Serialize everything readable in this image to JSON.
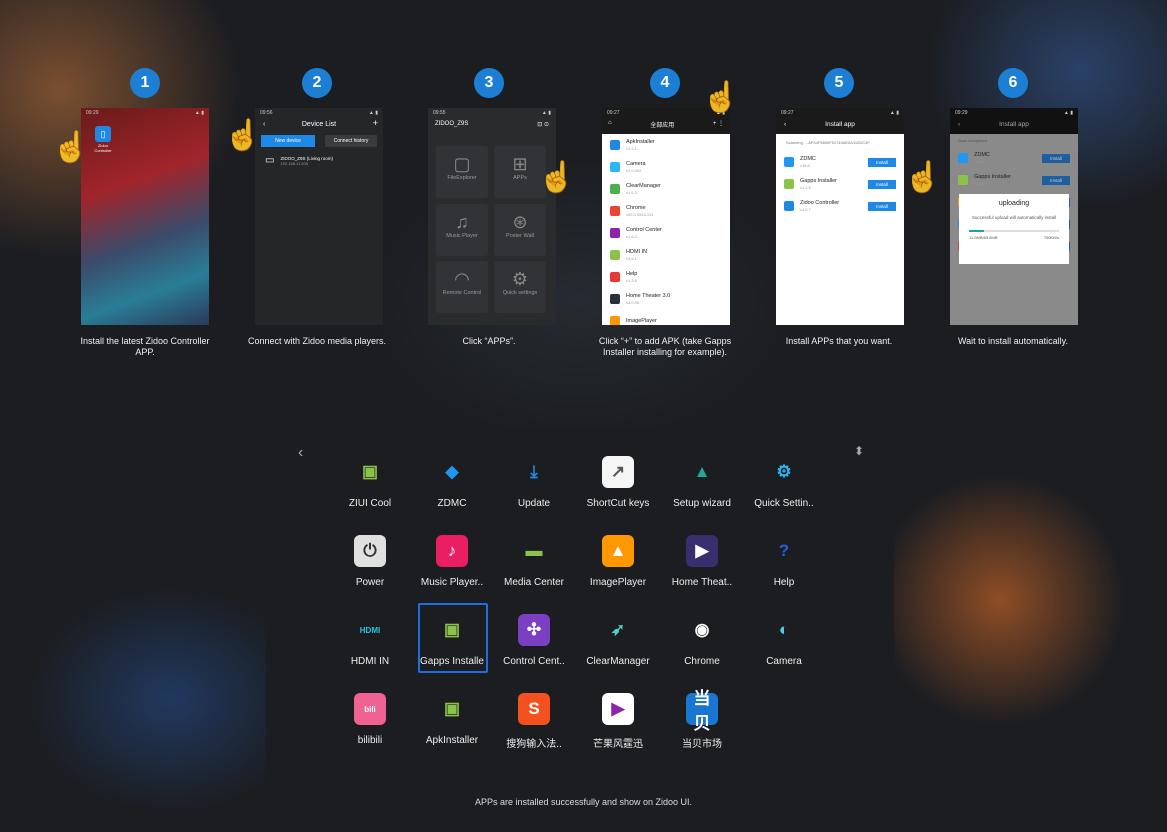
{
  "steps": [
    {
      "num": "1",
      "caption": "Install the latest Zidoo Controller APP."
    },
    {
      "num": "2",
      "caption": "Connect with Zidoo media players."
    },
    {
      "num": "3",
      "caption": "Click “APPs”."
    },
    {
      "num": "4",
      "caption": "Click “+” to add APK (take Gapps Installer installing for example)."
    },
    {
      "num": "5",
      "caption": "Install APPs that you want."
    },
    {
      "num": "6",
      "caption": "Wait to install automatically."
    }
  ],
  "phone1": {
    "time": "09:29",
    "app_label": "Zidoo Controller"
  },
  "phone2": {
    "time": "09:56",
    "title": "Device List",
    "new_device": "New device",
    "history": "Connect history",
    "device_name": "ZIDOO_Z9S (Living room)",
    "device_ip": "192.168.11.205"
  },
  "phone3": {
    "time": "09:55",
    "header": "ZIDOO_Z9S",
    "tiles": [
      "FileExplorer",
      "APPs",
      "Music Player",
      "Poster Wall",
      "Remote Control",
      "Quick settings"
    ]
  },
  "phone4": {
    "time": "09:27",
    "title": "全部应用",
    "apps": [
      {
        "name": "ApkInstaller",
        "ver": "v1.3.1"
      },
      {
        "name": "Camera",
        "ver": "v2.0.002"
      },
      {
        "name": "ClearManager",
        "ver": "v1.6.3"
      },
      {
        "name": "Chrome",
        "ver": "v92.0.4515.131"
      },
      {
        "name": "Control Center",
        "ver": "v1.6.2"
      },
      {
        "name": "HDMI IN",
        "ver": "v4.6.1"
      },
      {
        "name": "Help",
        "ver": "v1.3.5"
      },
      {
        "name": "Home Theater 3.0",
        "ver": "v3.0.05"
      },
      {
        "name": "ImagePlayer",
        "ver": ""
      }
    ]
  },
  "phone5": {
    "time": "09:27",
    "title": "Install app",
    "scanning": "Scanning:",
    "path": "...AF54F5600F51745AE0A110DC3F",
    "apps": [
      {
        "name": "ZDMC",
        "ver": "v18.6"
      },
      {
        "name": "Gapps Installer",
        "ver": "v1.2.6"
      },
      {
        "name": "Zidoo Controller",
        "ver": "v1.6.7"
      }
    ],
    "install": "Install"
  },
  "phone6": {
    "time": "09:29",
    "title": "Install app",
    "scan_done": "Scan completed",
    "dialog_title": "uploading",
    "dialog_msg": "Successful upload will automatically install",
    "progress": "11.0MB/65.0MB",
    "speed": "760KB/s",
    "progress_fraction": 0.17,
    "apps": [
      {
        "name": "ZDMC",
        "ver": "v18.6"
      },
      {
        "name": "Gapps Installer",
        "ver": "v1.2.6"
      },
      {
        "name": "File Manager",
        "ver": "v1.0.2"
      },
      {
        "name": "Zidoo Controller",
        "ver": "v1.6.7"
      },
      {
        "name": "芒果风暴迅",
        "ver": ""
      }
    ],
    "install": "Install"
  },
  "panel": {
    "rows": [
      [
        {
          "label": "ZIUI Cool",
          "icon": "android-icon",
          "bg": "#1c1d20",
          "fg": "#8bc34a"
        },
        {
          "label": "ZDMC",
          "icon": "zdmc-icon",
          "bg": "#1c1d20",
          "fg": "#2196f3"
        },
        {
          "label": "Update",
          "icon": "download-icon",
          "bg": "#1c1d20",
          "fg": "#1e88e5"
        },
        {
          "label": "ShortCut keys",
          "icon": "shortcut-icon",
          "bg": "#f5f5f5",
          "fg": "#555"
        },
        {
          "label": "Setup wizard",
          "icon": "shapes-icon",
          "bg": "#1c1d20",
          "fg": "#26a69a"
        },
        {
          "label": "Quick Settin..",
          "icon": "gear-icon",
          "bg": "#1c1d20",
          "fg": "#29b6f6"
        }
      ],
      [
        {
          "label": "Power",
          "icon": "power-icon",
          "bg": "#e0e0e0",
          "fg": "#333"
        },
        {
          "label": "Music Player..",
          "icon": "music-icon",
          "bg": "#e91e63",
          "fg": "#fff"
        },
        {
          "label": "Media Center",
          "icon": "folder-icon",
          "bg": "#1c1d20",
          "fg": "#8bc34a"
        },
        {
          "label": "ImagePlayer",
          "icon": "image-icon",
          "bg": "#ff9800",
          "fg": "#fff"
        },
        {
          "label": "Home Theat..",
          "icon": "film-icon",
          "bg": "#3a2f6e",
          "fg": "#fff"
        },
        {
          "label": "Help",
          "icon": "help-icon",
          "bg": "#1c1d20",
          "fg": "#1e63d8"
        }
      ],
      [
        {
          "label": "HDMI IN",
          "icon": "hdmi-icon",
          "bg": "#1c1d20",
          "fg": "#26c6da"
        },
        {
          "label": "Gapps Installe",
          "icon": "android-icon",
          "bg": "#1c1d20",
          "fg": "#8bc34a"
        },
        {
          "label": "Control Cent..",
          "icon": "remote-icon",
          "bg": "#7b3fc4",
          "fg": "#fff"
        },
        {
          "label": "ClearManager",
          "icon": "rocket-icon",
          "bg": "#1c1d20",
          "fg": "#4dd0c8"
        },
        {
          "label": "Chrome",
          "icon": "chrome-icon",
          "bg": "#1c1d20",
          "fg": "#fff"
        },
        {
          "label": "Camera",
          "icon": "camera-icon",
          "bg": "#1c1d20",
          "fg": "#4dd0e1"
        }
      ],
      [
        {
          "label": "bilibili",
          "icon": "bilibili-icon",
          "bg": "#f06292",
          "fg": "#fff"
        },
        {
          "label": "ApkInstaller",
          "icon": "android-icon",
          "bg": "#1c1d20",
          "fg": "#8bc34a"
        },
        {
          "label": "搜狗输入法..",
          "icon": "sogou-icon",
          "bg": "#f4511e",
          "fg": "#fff"
        },
        {
          "label": "芒果风霆迅",
          "icon": "mango-icon",
          "bg": "#fff",
          "fg": "#8e24aa"
        },
        {
          "label": "当贝市场",
          "icon": "dangbei-icon",
          "bg": "#1976d2",
          "fg": "#fff"
        }
      ]
    ]
  },
  "footer": "APPs are installed successfully and show on Zidoo UI."
}
